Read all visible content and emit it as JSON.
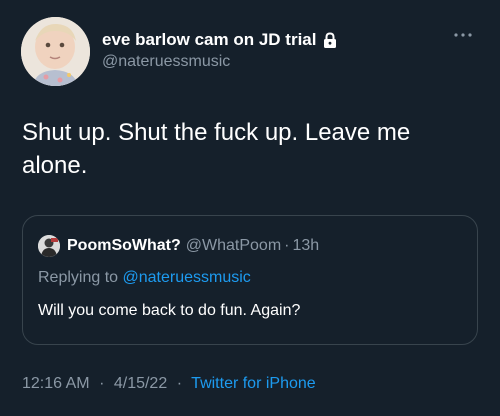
{
  "tweet": {
    "author": {
      "display_name": "eve barlow cam on JD trial",
      "handle": "@nateruessmusic",
      "protected_icon": "lock-icon"
    },
    "menu_icon": "more-horizontal-icon",
    "text": "Shut up. Shut the fuck up. Leave me alone.",
    "quoted_tweet": {
      "display_name": "PoomSoWhat?",
      "handle": "@WhatPoom",
      "separator": "·",
      "time": "13h",
      "replying_prefix": "Replying to",
      "replying_to": "@nateruessmusic",
      "text": "Will you come back to do fun. Again?"
    },
    "meta": {
      "time": "12:16 AM",
      "separator": "·",
      "date": "4/15/22",
      "separator2": "·",
      "source": "Twitter for iPhone"
    }
  },
  "colors": {
    "background": "#15202b",
    "primary_text": "#ffffff",
    "secondary_text": "#8b98a5",
    "link": "#1d9bf0",
    "border": "#38444d"
  }
}
